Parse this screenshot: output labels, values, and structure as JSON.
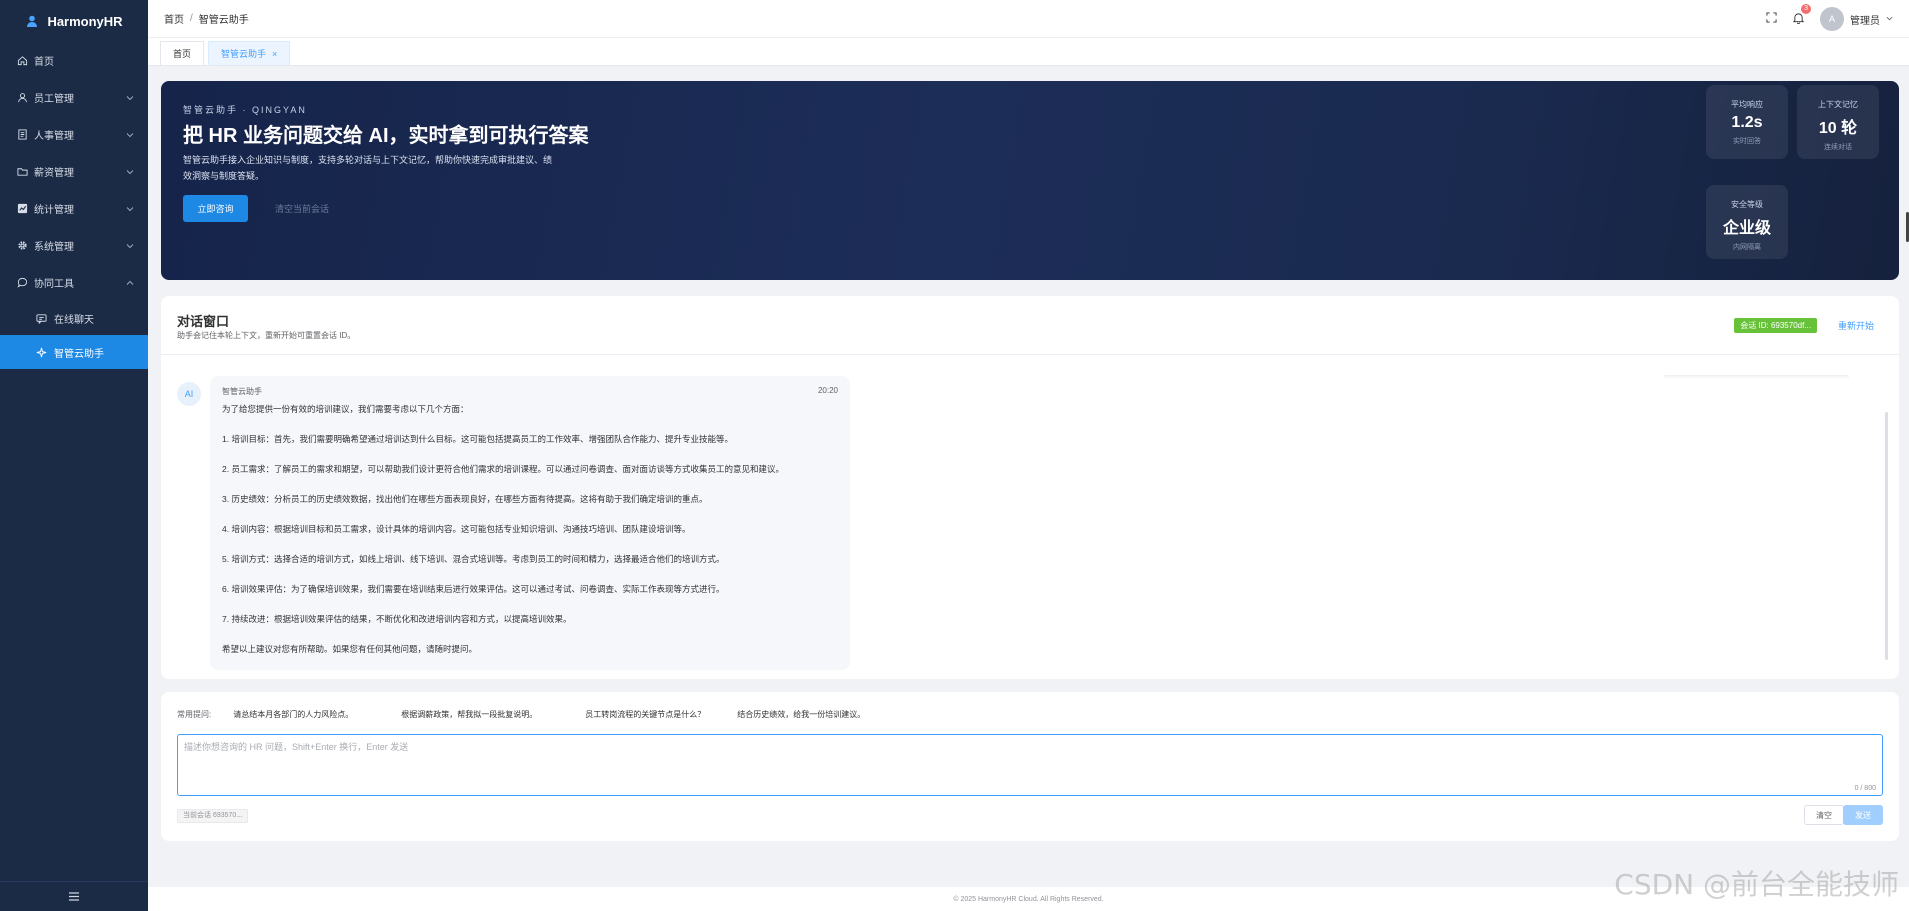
{
  "sidebar": {
    "brand": "HarmonyHR",
    "items": [
      {
        "label": "首页",
        "icon": "home-icon"
      },
      {
        "label": "员工管理",
        "icon": "user-icon"
      },
      {
        "label": "人事管理",
        "icon": "document-icon"
      },
      {
        "label": "薪资管理",
        "icon": "folder-icon"
      },
      {
        "label": "统计管理",
        "icon": "chart-icon"
      },
      {
        "label": "系统管理",
        "icon": "gear-icon"
      },
      {
        "label": "协同工具",
        "icon": "chat-icon"
      }
    ],
    "subitems": [
      {
        "label": "在线聊天",
        "icon": "message-icon"
      },
      {
        "label": "智管云助手",
        "icon": "sparkle-icon",
        "active": true
      }
    ]
  },
  "header": {
    "breadcrumb": [
      "首页",
      "智管云助手"
    ],
    "notification_count": "3",
    "avatar_letter": "A",
    "username": "管理员"
  },
  "tabs": [
    {
      "label": "首页"
    },
    {
      "label": "智管云助手",
      "active": true,
      "close": "×"
    }
  ],
  "banner": {
    "eyebrow": "智管云助手 · QINGYAN",
    "title": "把 HR 业务问题交给 AI，实时拿到可执行答案",
    "desc": "智管云助手接入企业知识与制度，支持多轮对话与上下文记忆，帮助你快速完成审批建议、绩效洞察与制度答疑。",
    "primary_button": "立即咨询",
    "secondary_button": "清空当前会话",
    "stats": [
      {
        "label": "平均响应",
        "value": "1.2s",
        "sub": "实时回答"
      },
      {
        "label": "上下文记忆",
        "value": "10 轮",
        "sub": "连续对话"
      },
      {
        "label": "安全等级",
        "value": "企业级",
        "sub": "内网隔离"
      }
    ]
  },
  "chat": {
    "title": "对话窗口",
    "subtitle": "助手会记住本轮上下文，重新开始可重置会话 ID。",
    "session_tag": "会话 ID: 693570df...",
    "restart": "重新开始",
    "message": {
      "avatar": "AI",
      "sender": "智管云助手",
      "time": "20:20",
      "paragraphs": [
        "为了给您提供一份有效的培训建议，我们需要考虑以下几个方面：",
        "1. 培训目标：首先，我们需要明确希望通过培训达到什么目标。这可能包括提高员工的工作效率、增强团队合作能力、提升专业技能等。",
        "2. 员工需求：了解员工的需求和期望，可以帮助我们设计更符合他们需求的培训课程。可以通过问卷调查、面对面访谈等方式收集员工的意见和建议。",
        "3. 历史绩效：分析员工的历史绩效数据，找出他们在哪些方面表现良好，在哪些方面有待提高。这将有助于我们确定培训的重点。",
        "4. 培训内容：根据培训目标和员工需求，设计具体的培训内容。这可能包括专业知识培训、沟通技巧培训、团队建设培训等。",
        "5. 培训方式：选择合适的培训方式，如线上培训、线下培训、混合式培训等。考虑到员工的时间和精力，选择最适合他们的培训方式。",
        "6. 培训效果评估：为了确保培训效果，我们需要在培训结束后进行效果评估。这可以通过考试、问卷调查、实际工作表现等方式进行。",
        "7. 持续改进：根据培训效果评估的结果，不断优化和改进培训内容和方式，以提高培训效果。",
        "希望以上建议对您有所帮助。如果您有任何其他问题，请随时提问。"
      ]
    }
  },
  "input": {
    "quick_label": "常用提问:",
    "quick_questions": [
      "请总结本月各部门的人力风险点。",
      "根据调薪政策，帮我拟一段批复说明。",
      "员工转岗流程的关键节点是什么？",
      "结合历史绩效，给我一份培训建议。"
    ],
    "placeholder": "描述你想咨询的 HR 问题，Shift+Enter 换行，Enter 发送",
    "counter": "0 / 800",
    "session_chip": "当前会话 693570...",
    "clear_button": "清空",
    "send_button": "发送"
  },
  "footer": "© 2025 HarmonyHR Cloud. All Rights Reserved.",
  "watermark": "CSDN @前台全能技师",
  "colors": {
    "accent": "#1e88e5",
    "sidebar": "#1b2a45",
    "banner": "#1c2d58",
    "tag_green": "#67c23a"
  }
}
